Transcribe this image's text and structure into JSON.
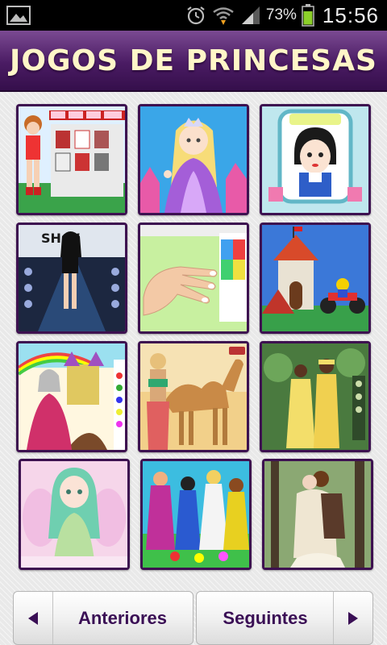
{
  "status_bar": {
    "battery_percent": "73%",
    "time": "15:56",
    "icons": [
      "gallery-icon",
      "alarm-icon",
      "wifi-icon",
      "signal-icon",
      "battery-icon"
    ]
  },
  "header": {
    "title": "JOGOS DE PRINCESAS"
  },
  "tiles": [
    {
      "name": "game-thumbnail-1",
      "scene": "dress-up-doll"
    },
    {
      "name": "game-thumbnail-2",
      "scene": "princess-castle"
    },
    {
      "name": "game-thumbnail-3",
      "scene": "snow-white-makeup"
    },
    {
      "name": "game-thumbnail-4",
      "scene": "fashion-show"
    },
    {
      "name": "game-thumbnail-5",
      "scene": "nail-art"
    },
    {
      "name": "game-thumbnail-6",
      "scene": "motorbike-castle"
    },
    {
      "name": "game-thumbnail-7",
      "scene": "fairy-coloring"
    },
    {
      "name": "game-thumbnail-8",
      "scene": "camel-desert"
    },
    {
      "name": "game-thumbnail-9",
      "scene": "african-wedding"
    },
    {
      "name": "game-thumbnail-10",
      "scene": "green-haired-fairy"
    },
    {
      "name": "game-thumbnail-11",
      "scene": "princess-group"
    },
    {
      "name": "game-thumbnail-12",
      "scene": "forest-couple"
    }
  ],
  "navigation": {
    "prev_label": "Anteriores",
    "next_label": "Seguintes"
  },
  "colors": {
    "header_purple": "#4a1b63",
    "title_text": "#fff6c8",
    "button_text": "#3a0f55"
  }
}
